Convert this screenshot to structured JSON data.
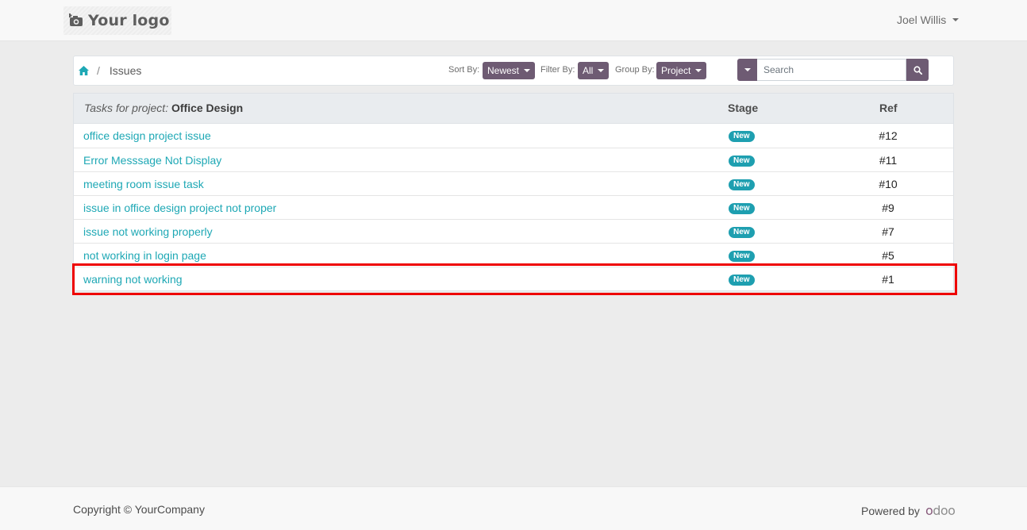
{
  "header": {
    "logo_text": "Your logo",
    "user_name": "Joel Willis"
  },
  "toolbar": {
    "breadcrumb_current": "Issues",
    "breadcrumb_separator": "/",
    "sort_label": "Sort By:",
    "sort_value": "Newest",
    "filter_label": "Filter By:",
    "filter_value": "All",
    "group_label": "Group By:",
    "group_value": "Project",
    "search_placeholder": "Search"
  },
  "table": {
    "title_prefix": "Tasks for project:",
    "project_name": "Office Design",
    "col_stage": "Stage",
    "col_ref": "Ref",
    "rows": [
      {
        "name": "office design project issue",
        "stage": "New",
        "ref": "#12"
      },
      {
        "name": "Error Messsage Not Display",
        "stage": "New",
        "ref": "#11"
      },
      {
        "name": "meeting room issue task",
        "stage": "New",
        "ref": "#10"
      },
      {
        "name": "issue in office design project not proper",
        "stage": "New",
        "ref": "#9"
      },
      {
        "name": "issue not working properly",
        "stage": "New",
        "ref": "#7"
      },
      {
        "name": "not working in login page",
        "stage": "New",
        "ref": "#5"
      },
      {
        "name": "warning not working",
        "stage": "New",
        "ref": "#1"
      }
    ]
  },
  "footer": {
    "copyright": "Copyright © YourCompany",
    "powered_by": "Powered by",
    "brand": "odoo"
  },
  "colors": {
    "accent": "#6e5b73",
    "link": "#1ea8b5",
    "badge": "#1e9fb0",
    "highlight": "#ee0000"
  }
}
